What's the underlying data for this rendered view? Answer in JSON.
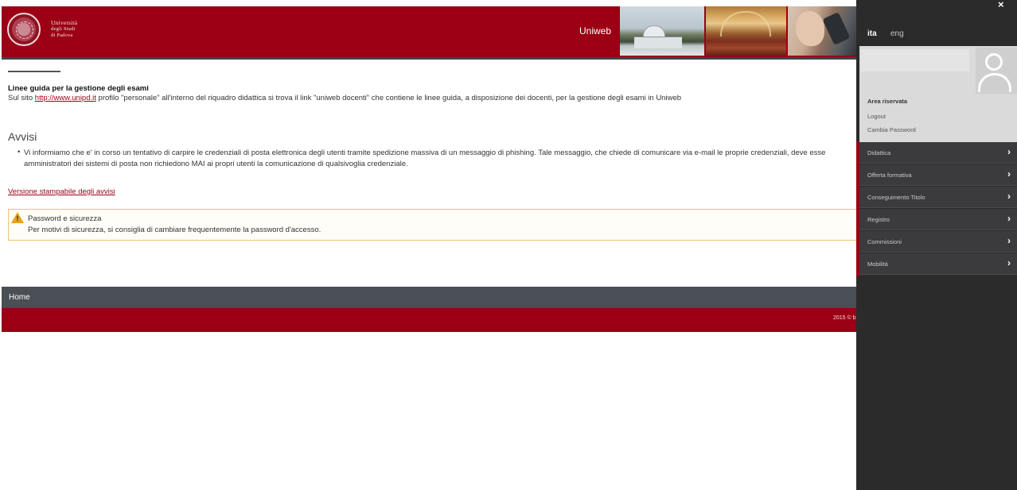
{
  "header": {
    "logo_lines": [
      "Università",
      "degli Studi",
      "di Padova"
    ],
    "app_title": "Uniweb",
    "brand_color": "#9b0014"
  },
  "main": {
    "guide": {
      "title": "Linee guida per la gestione degli esami",
      "text_before": "Sul sito ",
      "link": "http://www.unipd.it",
      "text_after": " profilo \"personale\" all'interno del riquadro didattica si trova il link \"uniweb docenti\" che contiene le linee guida, a disposizione dei docenti, per la gestione degli esami in Uniweb"
    },
    "avvisi": {
      "heading": "Avvisi",
      "items": [
        "Vi informiamo che e' in corso un tentativo di carpire le credenziali di posta elettronica degli utenti tramite spedizione massiva di un messaggio di phishing. Tale messaggio, che chiede di comunicare via e-mail le proprie credenziali, deve esse amministratori dei sistemi di posta non richiedono MAI ai propri utenti la comunicazione di qualsivoglia credenziale."
      ]
    },
    "print_link": "Versione stampabile degli avvisi",
    "alert": {
      "icon": "warning-icon",
      "title": "Password e sicurezza",
      "text": "Per motivi di sicurezza, si consiglia di cambiare frequentemente la password d'accesso."
    }
  },
  "footer": {
    "home": "Home",
    "copyright": "2015 © b"
  },
  "side_panel": {
    "close": "×",
    "languages": {
      "active": "ita",
      "other": "eng"
    },
    "user": {
      "area_label": "Area riservata",
      "logout": "Logout",
      "change_password": "Cambia Password"
    },
    "menu": [
      {
        "label": "Didattica"
      },
      {
        "label": "Offerta formativa"
      },
      {
        "label": "Conseguimento Titolo"
      },
      {
        "label": "Registro"
      },
      {
        "label": "Commissioni"
      },
      {
        "label": "Mobilità"
      }
    ],
    "chevron": "›"
  }
}
